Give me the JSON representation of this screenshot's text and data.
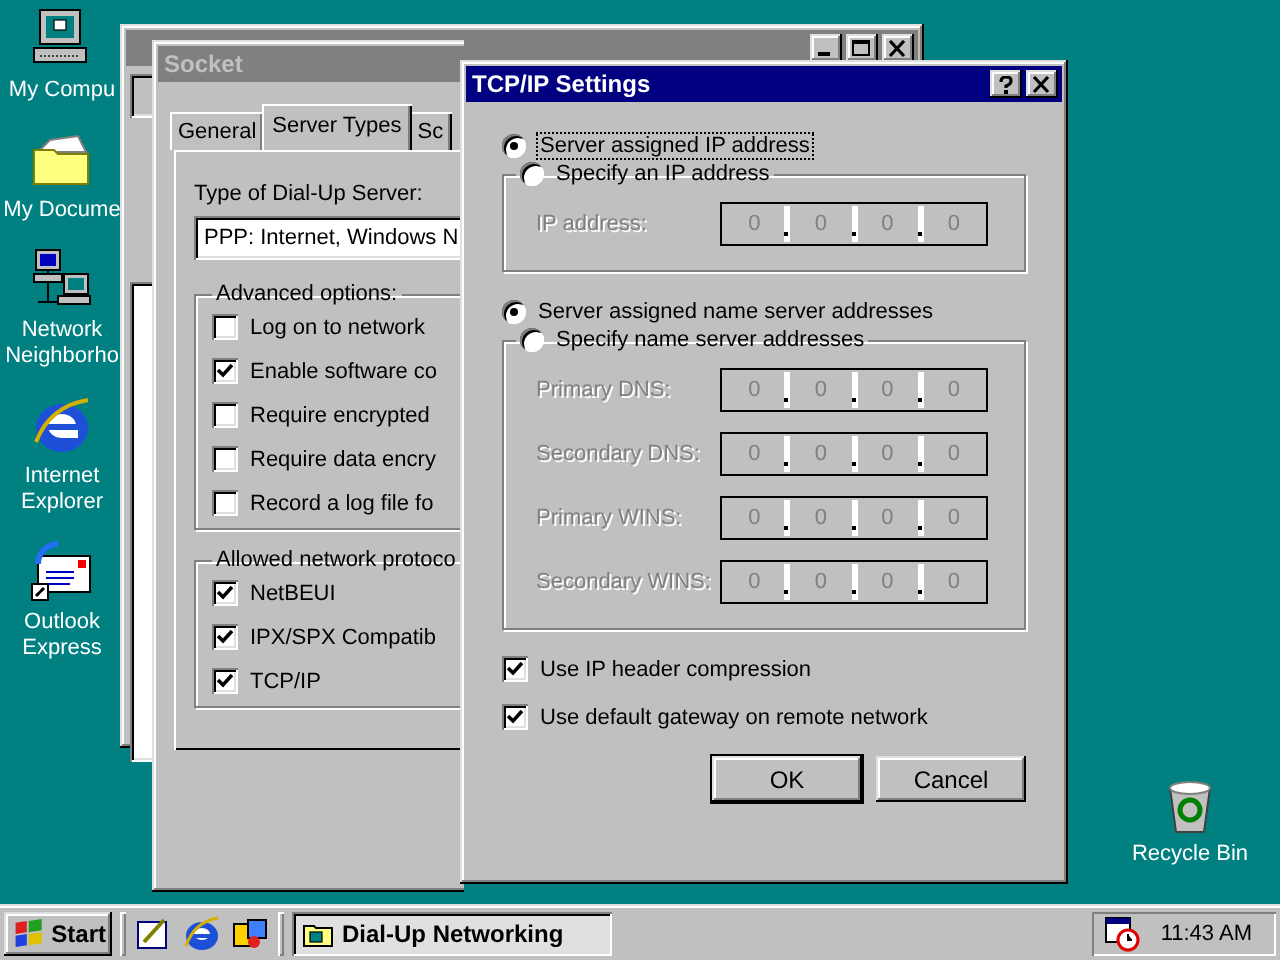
{
  "desktop_icons": [
    {
      "kind": "computer",
      "label": "My Compu"
    },
    {
      "kind": "documents",
      "label": "My Docume"
    },
    {
      "kind": "network",
      "label": "Network Neighborho"
    },
    {
      "kind": "browser",
      "label": "Internet Explorer"
    },
    {
      "kind": "mail",
      "label": "Outlook Express"
    }
  ],
  "recycle_bin": {
    "kind": "recycle",
    "label": "Recycle Bin"
  },
  "socket_window": {
    "title": "Socket",
    "active": false,
    "tabs": [
      {
        "label": "General",
        "selected": false
      },
      {
        "label": "Server Types",
        "selected": true
      },
      {
        "label": "Sc",
        "selected": false
      }
    ],
    "server_type_label": "Type of Dial-Up Server:",
    "server_type_value": "PPP: Internet, Windows N",
    "advanced_options": {
      "legend": "Advanced options:",
      "options": [
        {
          "label": "Log on to network",
          "checked": false
        },
        {
          "label": "Enable software co",
          "checked": true
        },
        {
          "label": "Require encrypted",
          "checked": false
        },
        {
          "label": "Require data encry",
          "checked": false
        },
        {
          "label": "Record a log file fo",
          "checked": false
        }
      ]
    },
    "allowed_protocols": {
      "legend": "Allowed network protoco",
      "options": [
        {
          "label": "NetBEUI",
          "checked": true
        },
        {
          "label": "IPX/SPX Compatib",
          "checked": true
        },
        {
          "label": "TCP/IP",
          "checked": true
        }
      ]
    }
  },
  "tcpip_dialog": {
    "title": "TCP/IP Settings",
    "active": true,
    "ip_server_option": {
      "label": "Server assigned IP address",
      "selected": true
    },
    "ip_specify_option": {
      "label": "Specify an IP address",
      "selected": false
    },
    "ip_fields": [
      {
        "label": "IP address:",
        "disabled": true,
        "octets": [
          "0",
          "0",
          "0",
          "0"
        ]
      }
    ],
    "ns_server_option": {
      "label": "Server assigned name server addresses",
      "selected": true
    },
    "ns_specify_option": {
      "label": "Specify name server addresses",
      "selected": false
    },
    "ns_fields": [
      {
        "label": "Primary DNS:",
        "disabled": true,
        "octets": [
          "0",
          "0",
          "0",
          "0"
        ]
      },
      {
        "label": "Secondary DNS:",
        "disabled": true,
        "octets": [
          "0",
          "0",
          "0",
          "0"
        ]
      },
      {
        "label": "Primary WINS:",
        "disabled": true,
        "octets": [
          "0",
          "0",
          "0",
          "0"
        ]
      },
      {
        "label": "Secondary WINS:",
        "disabled": true,
        "octets": [
          "0",
          "0",
          "0",
          "0"
        ]
      }
    ],
    "checkboxes": [
      {
        "label": "Use IP header compression",
        "checked": true
      },
      {
        "label": "Use default gateway on remote network",
        "checked": true
      }
    ],
    "buttons": [
      "OK",
      "Cancel"
    ]
  },
  "taskbar": {
    "start": "Start",
    "tasks": [
      {
        "label": "Dial-Up Networking",
        "selected": true
      }
    ],
    "clock": "11:43 AM"
  }
}
